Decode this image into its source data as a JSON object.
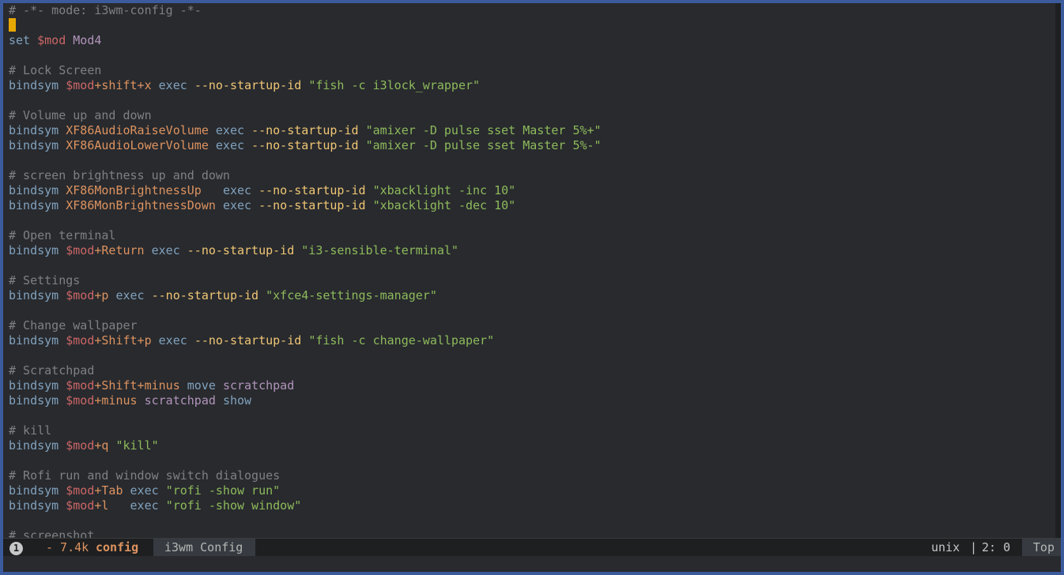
{
  "editor": {
    "lines": [
      [
        [
          "c-comment",
          "# -*- mode: i3wm-config -*-"
        ]
      ],
      [
        [
          "cursor",
          ""
        ]
      ],
      [
        [
          "c-kw",
          "set "
        ],
        [
          "c-var",
          "$mod "
        ],
        [
          "c-purple",
          "Mod4"
        ]
      ],
      [],
      [
        [
          "c-comment",
          "# Lock Screen"
        ]
      ],
      [
        [
          "c-kw",
          "bindsym "
        ],
        [
          "c-var",
          "$mod"
        ],
        [
          "c-key",
          "+shift+x "
        ],
        [
          "c-kw",
          "exec "
        ],
        [
          "c-flag",
          "--no-startup-id "
        ],
        [
          "c-str",
          "\"fish -c i3lock_wrapper\""
        ]
      ],
      [],
      [
        [
          "c-comment",
          "# Volume up and down"
        ]
      ],
      [
        [
          "c-kw",
          "bindsym "
        ],
        [
          "c-key",
          "XF86AudioRaiseVolume "
        ],
        [
          "c-kw",
          "exec "
        ],
        [
          "c-flag",
          "--no-startup-id "
        ],
        [
          "c-str",
          "\"amixer -D pulse sset Master 5%+\""
        ]
      ],
      [
        [
          "c-kw",
          "bindsym "
        ],
        [
          "c-key",
          "XF86AudioLowerVolume "
        ],
        [
          "c-kw",
          "exec "
        ],
        [
          "c-flag",
          "--no-startup-id "
        ],
        [
          "c-str",
          "\"amixer -D pulse sset Master 5%-\""
        ]
      ],
      [],
      [
        [
          "c-comment",
          "# screen brightness up and down"
        ]
      ],
      [
        [
          "c-kw",
          "bindsym "
        ],
        [
          "c-key",
          "XF86MonBrightnessUp   "
        ],
        [
          "c-kw",
          "exec "
        ],
        [
          "c-flag",
          "--no-startup-id "
        ],
        [
          "c-str",
          "\"xbacklight -inc 10\""
        ]
      ],
      [
        [
          "c-kw",
          "bindsym "
        ],
        [
          "c-key",
          "XF86MonBrightnessDown "
        ],
        [
          "c-kw",
          "exec "
        ],
        [
          "c-flag",
          "--no-startup-id "
        ],
        [
          "c-str",
          "\"xbacklight -dec 10\""
        ]
      ],
      [],
      [
        [
          "c-comment",
          "# Open terminal"
        ]
      ],
      [
        [
          "c-kw",
          "bindsym "
        ],
        [
          "c-var",
          "$mod"
        ],
        [
          "c-key",
          "+Return "
        ],
        [
          "c-kw",
          "exec "
        ],
        [
          "c-flag",
          "--no-startup-id "
        ],
        [
          "c-str",
          "\"i3-sensible-terminal\""
        ]
      ],
      [],
      [
        [
          "c-comment",
          "# Settings"
        ]
      ],
      [
        [
          "c-kw",
          "bindsym "
        ],
        [
          "c-var",
          "$mod"
        ],
        [
          "c-key",
          "+p "
        ],
        [
          "c-kw",
          "exec "
        ],
        [
          "c-flag",
          "--no-startup-id "
        ],
        [
          "c-str",
          "\"xfce4-settings-manager\""
        ]
      ],
      [],
      [
        [
          "c-comment",
          "# Change wallpaper"
        ]
      ],
      [
        [
          "c-kw",
          "bindsym "
        ],
        [
          "c-var",
          "$mod"
        ],
        [
          "c-key",
          "+Shift+p "
        ],
        [
          "c-kw",
          "exec "
        ],
        [
          "c-flag",
          "--no-startup-id "
        ],
        [
          "c-str",
          "\"fish -c change-wallpaper\""
        ]
      ],
      [],
      [
        [
          "c-comment",
          "# Scratchpad"
        ]
      ],
      [
        [
          "c-kw",
          "bindsym "
        ],
        [
          "c-var",
          "$mod"
        ],
        [
          "c-key",
          "+Shift+minus "
        ],
        [
          "c-kw",
          "move "
        ],
        [
          "c-purple",
          "scratchpad"
        ]
      ],
      [
        [
          "c-kw",
          "bindsym "
        ],
        [
          "c-var",
          "$mod"
        ],
        [
          "c-key",
          "+minus "
        ],
        [
          "c-purple",
          "scratchpad "
        ],
        [
          "c-kw",
          "show"
        ]
      ],
      [],
      [
        [
          "c-comment",
          "# kill"
        ]
      ],
      [
        [
          "c-kw",
          "bindsym "
        ],
        [
          "c-var",
          "$mod"
        ],
        [
          "c-key",
          "+q "
        ],
        [
          "c-str",
          "\"kill\""
        ]
      ],
      [],
      [
        [
          "c-comment",
          "# Rofi run and window switch dialogues"
        ]
      ],
      [
        [
          "c-kw",
          "bindsym "
        ],
        [
          "c-var",
          "$mod"
        ],
        [
          "c-key",
          "+Tab "
        ],
        [
          "c-kw",
          "exec "
        ],
        [
          "c-str",
          "\"rofi -show run\""
        ]
      ],
      [
        [
          "c-kw",
          "bindsym "
        ],
        [
          "c-var",
          "$mod"
        ],
        [
          "c-key",
          "+l   "
        ],
        [
          "c-kw",
          "exec "
        ],
        [
          "c-str",
          "\"rofi -show window\""
        ]
      ],
      [],
      [
        [
          "c-comment",
          "# screenshot"
        ]
      ]
    ]
  },
  "modeline": {
    "badge": "1",
    "size_prefix": "- 7.4k ",
    "buffer_name": "config",
    "major_mode": "i3wm Config",
    "encoding": "unix",
    "separator": " | ",
    "position": "2: 0",
    "scroll": "Top"
  },
  "colors": {
    "background": "#282a2e",
    "comment": "#7e8082",
    "keyword": "#81a2be",
    "key": "#de935f",
    "variable": "#cc6666",
    "string": "#8eba5b",
    "flag": "#f0c674",
    "builtin": "#b294bb",
    "cursor": "#e6a800"
  }
}
